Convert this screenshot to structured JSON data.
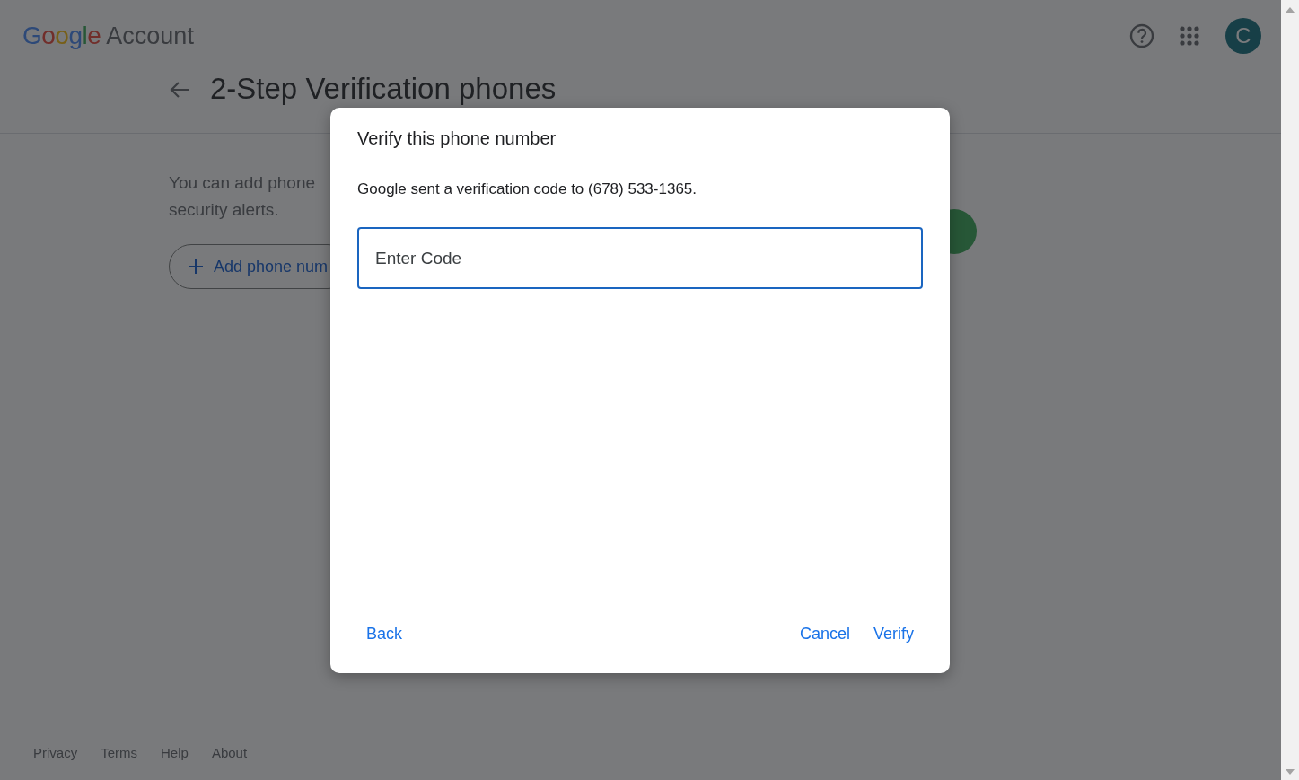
{
  "header": {
    "logo": "Google",
    "product": "Account",
    "avatar_letter": "C"
  },
  "page": {
    "title": "2-Step Verification phones",
    "description": [
      "You can add phone",
      "security alerts."
    ],
    "add_button": "Add phone num"
  },
  "footer": {
    "links": [
      "Privacy",
      "Terms",
      "Help",
      "About"
    ]
  },
  "dialog": {
    "title": "Verify this phone number",
    "message": "Google sent a verification code to (678) 533-1365.",
    "code_field": {
      "placeholder": "Enter Code",
      "focused": true
    },
    "left_buttons": [
      "Back"
    ],
    "right_buttons": [
      "Cancel",
      "Verify"
    ]
  }
}
